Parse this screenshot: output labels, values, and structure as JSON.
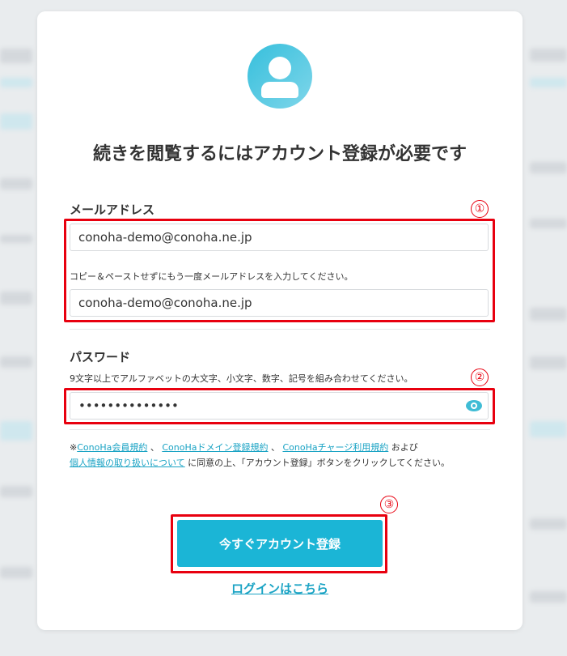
{
  "form": {
    "title": "続きを閲覧するにはアカウント登録が必要です",
    "email_label": "メールアドレス",
    "email_value": "conoha-demo@conoha.ne.jp",
    "email_confirm_hint": "コピー＆ペーストせずにもう一度メールアドレスを入力してください。",
    "email_confirm_value": "conoha-demo@conoha.ne.jp",
    "password_label": "パスワード",
    "password_hint": "9文字以上でアルファベットの大文字、小文字、数字、記号を組み合わせてください。",
    "password_value": "••••••••••••••",
    "submit_label": "今すぐアカウント登録",
    "login_link": "ログインはこちら"
  },
  "agreement": {
    "prefix": "※",
    "link1": "ConoHa会員規約",
    "sep1": "、",
    "link2": "ConoHaドメイン登録規約",
    "sep2": "、",
    "link3": "ConoHaチャージ利用規約",
    "and": "および",
    "link4": "個人情報の取り扱いについて",
    "suffix": "に同意の上、「アカウント登録」ボタンをクリックしてください。"
  },
  "annotations": {
    "n1": "①",
    "n2": "②",
    "n3": "③"
  },
  "colors": {
    "accent": "#1bb5d6",
    "annotation": "#e8000f"
  },
  "icons": {
    "avatar": "user-icon",
    "show_password": "eye-icon"
  }
}
